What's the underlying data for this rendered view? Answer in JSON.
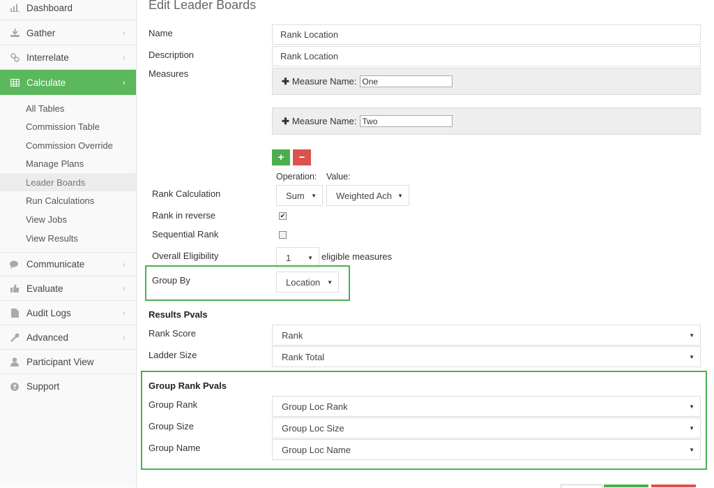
{
  "sidebar": {
    "items": [
      {
        "label": "Dashboard",
        "icon": "bar-chart-icon"
      },
      {
        "label": "Gather",
        "icon": "download-icon",
        "chevron": "‹"
      },
      {
        "label": "Interrelate",
        "icon": "link-icon",
        "chevron": "‹"
      },
      {
        "label": "Calculate",
        "icon": "table-icon",
        "chevron": "‹"
      },
      {
        "label": "Communicate",
        "icon": "comments-icon",
        "chevron": "‹"
      },
      {
        "label": "Evaluate",
        "icon": "thumbs-up-icon",
        "chevron": "‹"
      },
      {
        "label": "Audit Logs",
        "icon": "file-icon",
        "chevron": "‹"
      },
      {
        "label": "Advanced",
        "icon": "wrench-icon",
        "chevron": "‹"
      },
      {
        "label": "Participant View",
        "icon": "user-icon"
      },
      {
        "label": "Support",
        "icon": "question-icon"
      }
    ],
    "calculate_sub": [
      "All Tables",
      "Commission Table",
      "Commission Override",
      "Manage Plans",
      "Leader Boards",
      "Run Calculations",
      "View Jobs",
      "View Results"
    ],
    "accent_color": "#5cb85c"
  },
  "form": {
    "title": "Edit Leader Boards",
    "name_label": "Name",
    "name_value": "Rank Location",
    "description_label": "Description",
    "description_value": "Rank Location",
    "measures_label": "Measures",
    "measure_name_label": "Measure Name:",
    "measure1_value": "One",
    "measure2_value": "Two",
    "add_btn": "+",
    "remove_btn": "−",
    "operation_label": "Operation:",
    "value_label": "Value:",
    "rank_calc_label": "Rank Calculation",
    "operation_value": "Sum",
    "value_value": "Weighted Ach",
    "rank_reverse_label": "Rank in reverse",
    "rank_reverse_checked": "✔",
    "sequential_label": "Sequential Rank",
    "eligibility_label": "Overall Eligibility",
    "eligibility_value": "1",
    "eligibility_suffix": "eligible measures",
    "group_by_label": "Group By",
    "group_by_value": "Location",
    "results_head": "Results Pvals",
    "rank_score_label": "Rank Score",
    "rank_score_value": "Rank",
    "ladder_size_label": "Ladder Size",
    "ladder_size_value": "Rank Total",
    "group_head": "Group Rank Pvals",
    "group_rank_label": "Group Rank",
    "group_rank_value": "Group Loc Rank",
    "group_size_label": "Group Size",
    "group_size_value": "Group Loc Size",
    "group_name_label": "Group Name",
    "group_name_value": "Group Loc Name",
    "caret": "▼",
    "highlight_color": "#4caf50"
  }
}
